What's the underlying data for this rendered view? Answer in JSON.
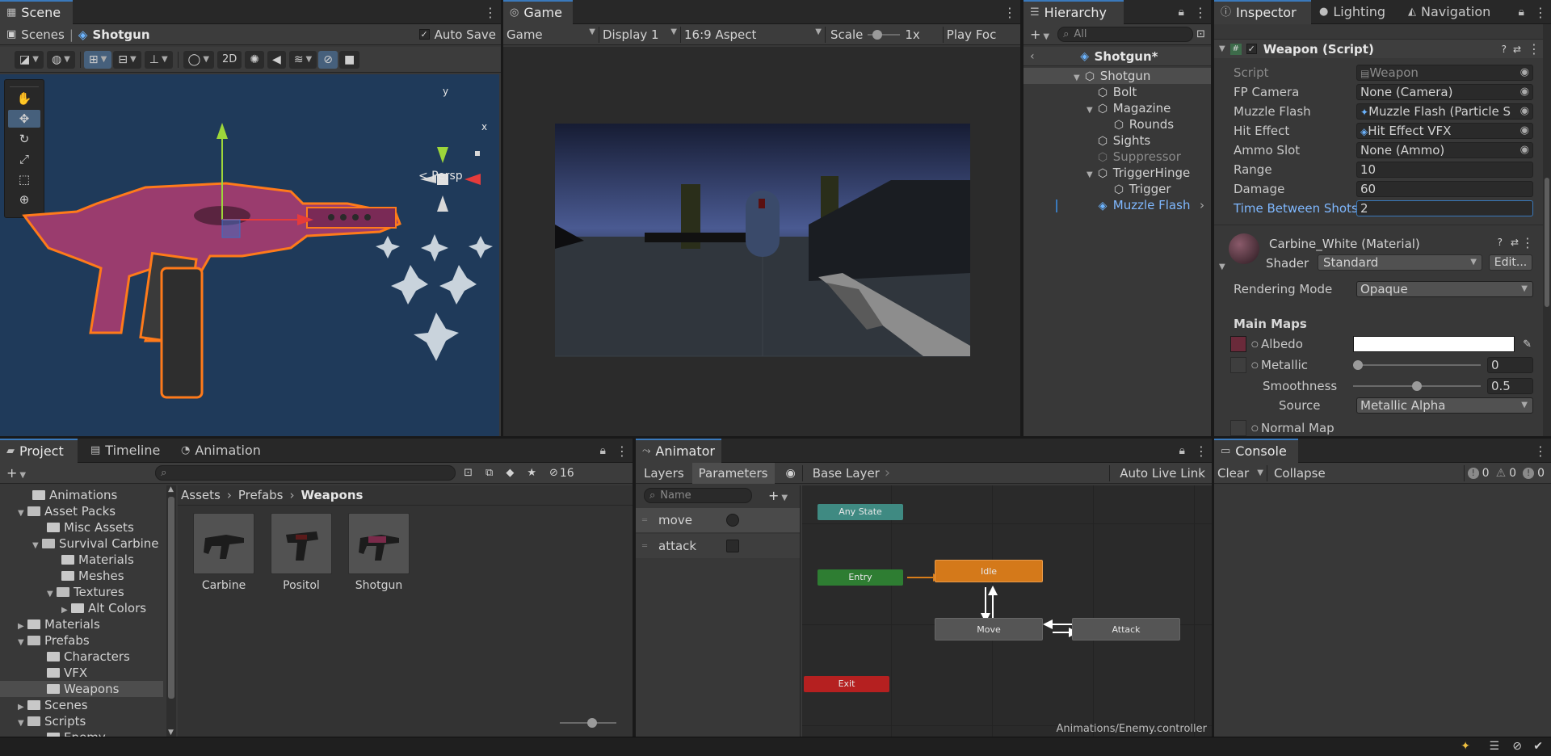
{
  "scene": {
    "tab": "Scene",
    "breadcrumb_scenes": "Scenes",
    "breadcrumb_object": "Shotgun",
    "auto_save": "Auto Save",
    "btn_2d": "2D",
    "gizmo_y": "y",
    "gizmo_x": "x",
    "persp": "< Persp"
  },
  "game": {
    "tab": "Game",
    "mode": "Game",
    "display": "Display 1",
    "aspect": "16:9 Aspect",
    "scale_label": "Scale",
    "scale_value": "1x",
    "play_focused": "Play Foc"
  },
  "hierarchy": {
    "tab": "Hierarchy",
    "search_placeholder": "All",
    "root": "Shotgun*",
    "items": [
      {
        "label": "Shotgun"
      },
      {
        "label": "Bolt"
      },
      {
        "label": "Magazine"
      },
      {
        "label": "Rounds"
      },
      {
        "label": "Sights"
      },
      {
        "label": "Suppressor"
      },
      {
        "label": "TriggerHinge"
      },
      {
        "label": "Trigger"
      },
      {
        "label": "Muzzle Flash"
      }
    ]
  },
  "inspector": {
    "tabs": [
      "Inspector",
      "Lighting",
      "Navigation"
    ],
    "component": "Weapon (Script)",
    "fields": [
      {
        "label": "Script",
        "value": "Weapon"
      },
      {
        "label": "FP Camera",
        "value": "None (Camera)"
      },
      {
        "label": "Muzzle Flash",
        "value": "Muzzle Flash (Particle S"
      },
      {
        "label": "Hit Effect",
        "value": "Hit Effect VFX"
      },
      {
        "label": "Ammo Slot",
        "value": "None (Ammo)"
      },
      {
        "label": "Range",
        "value": "10"
      },
      {
        "label": "Damage",
        "value": "60"
      },
      {
        "label": "Time Between Shots",
        "value": "2"
      }
    ],
    "material": "Carbine_White (Material)",
    "shader_label": "Shader",
    "shader_value": "Standard",
    "edit": "Edit...",
    "rendering_mode_label": "Rendering Mode",
    "rendering_mode_value": "Opaque",
    "main_maps": "Main Maps",
    "albedo": "Albedo",
    "metallic": "Metallic",
    "metallic_value": "0",
    "metallic_level": 0,
    "smoothness": "Smoothness",
    "smoothness_value": "0.5",
    "smoothness_level": 0.5,
    "source_label": "Source",
    "source_value": "Metallic Alpha",
    "normal_map": "Normal Map"
  },
  "project": {
    "tabs": [
      "Project",
      "Timeline",
      "Animation"
    ],
    "hidden_count": "16",
    "path": [
      "Assets",
      "Prefabs",
      "Weapons"
    ],
    "tree": [
      {
        "label": "Animations"
      },
      {
        "label": "Asset Packs"
      },
      {
        "label": "Misc Assets"
      },
      {
        "label": "Survival Carbine"
      },
      {
        "label": "Materials"
      },
      {
        "label": "Meshes"
      },
      {
        "label": "Textures"
      },
      {
        "label": "Alt Colors"
      },
      {
        "label": "Materials"
      },
      {
        "label": "Prefabs"
      },
      {
        "label": "Characters"
      },
      {
        "label": "VFX"
      },
      {
        "label": "Weapons"
      },
      {
        "label": "Scenes"
      },
      {
        "label": "Scripts"
      },
      {
        "label": "Enemy"
      }
    ],
    "assets": [
      {
        "label": "Carbine"
      },
      {
        "label": "Positol"
      },
      {
        "label": "Shotgun"
      }
    ]
  },
  "animator": {
    "tab": "Animator",
    "layers": "Layers",
    "parameters": "Parameters",
    "base_layer": "Base Layer",
    "auto_live_link": "Auto Live Link",
    "name_placeholder": "Name",
    "params": [
      {
        "label": "move"
      },
      {
        "label": "attack"
      }
    ],
    "states": {
      "any": "Any State",
      "entry": "Entry",
      "idle": "Idle",
      "move": "Move",
      "attack": "Attack",
      "exit": "Exit"
    },
    "footer": "Animations/Enemy.controller"
  },
  "console": {
    "tab": "Console",
    "clear": "Clear",
    "collapse": "Collapse",
    "info_count": "0",
    "warn_count": "0",
    "error_count": "0"
  }
}
